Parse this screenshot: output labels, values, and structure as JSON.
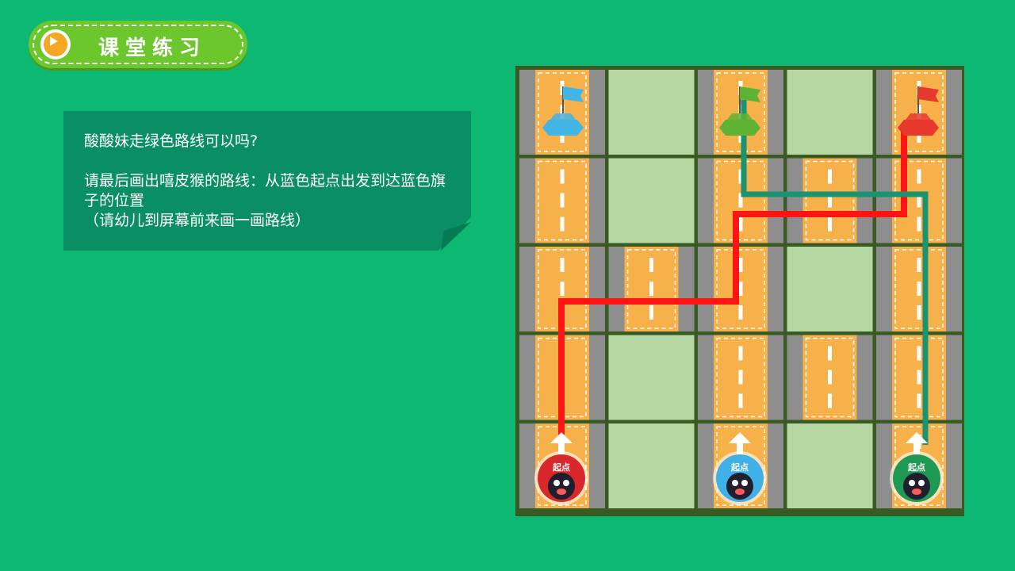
{
  "title": {
    "label": "课堂练习"
  },
  "question": {
    "line1": "酸酸妹走绿色路线可以吗?",
    "line2": "请最后画出嘻皮猴的路线：从蓝色起点出发到达蓝色旗子的位置",
    "line3": "（请幼儿到屏幕前来画一画路线）"
  },
  "board": {
    "start_label": "起点",
    "flags": [
      {
        "color": "blue",
        "hex": "#43b4e6"
      },
      {
        "color": "green",
        "hex": "#5fb333"
      },
      {
        "color": "red",
        "hex": "#e8382d"
      }
    ],
    "starts": [
      {
        "color": "red",
        "hex": "#d8282b"
      },
      {
        "color": "blue",
        "hex": "#3fb0e8"
      },
      {
        "color": "green",
        "hex": "#1e9a55"
      }
    ],
    "paths": [
      {
        "color": "red",
        "hex": "#ff1414"
      },
      {
        "color": "green",
        "hex": "#1a9470"
      }
    ]
  }
}
